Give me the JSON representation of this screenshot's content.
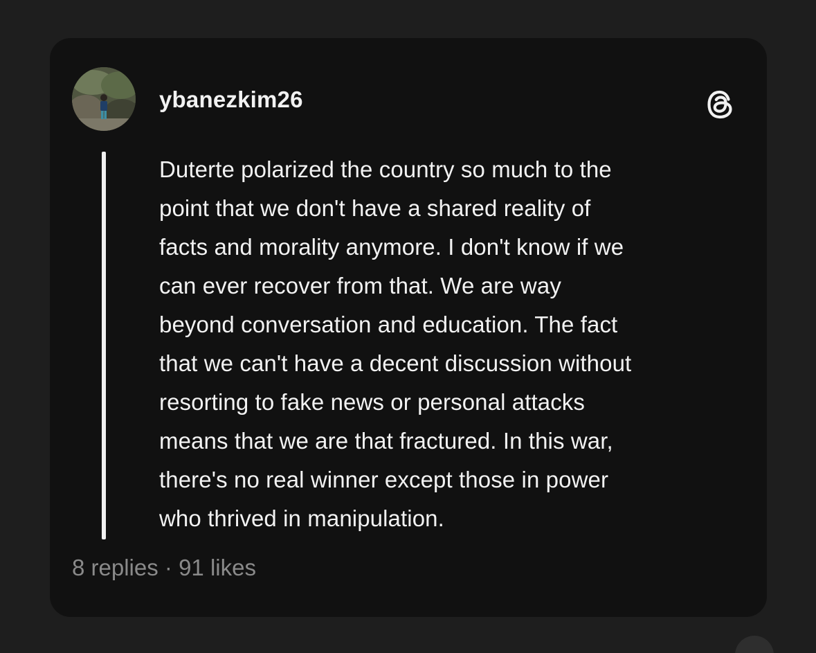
{
  "post": {
    "username": "ybanezkim26",
    "text": "Duterte polarized the country so much to the\npoint that we don't have a shared reality of\nfacts and morality anymore. I don't know if we\ncan ever recover from that. We are way\nbeyond conversation and education. The fact\nthat we can't have a decent discussion without\nresorting to fake news or personal attacks\nmeans that we are that fractured. In this war,\nthere's no real winner except those in power\nwho thrived in manipulation.",
    "replies": "8 replies",
    "separator": "·",
    "likes": "91 likes"
  },
  "icons": {
    "brand": "threads-logo-icon",
    "avatar": "user-avatar"
  },
  "colors": {
    "background": "#1e1e1e",
    "card": "#111111",
    "text": "#f2f2f2",
    "muted": "#8a8a8a"
  }
}
